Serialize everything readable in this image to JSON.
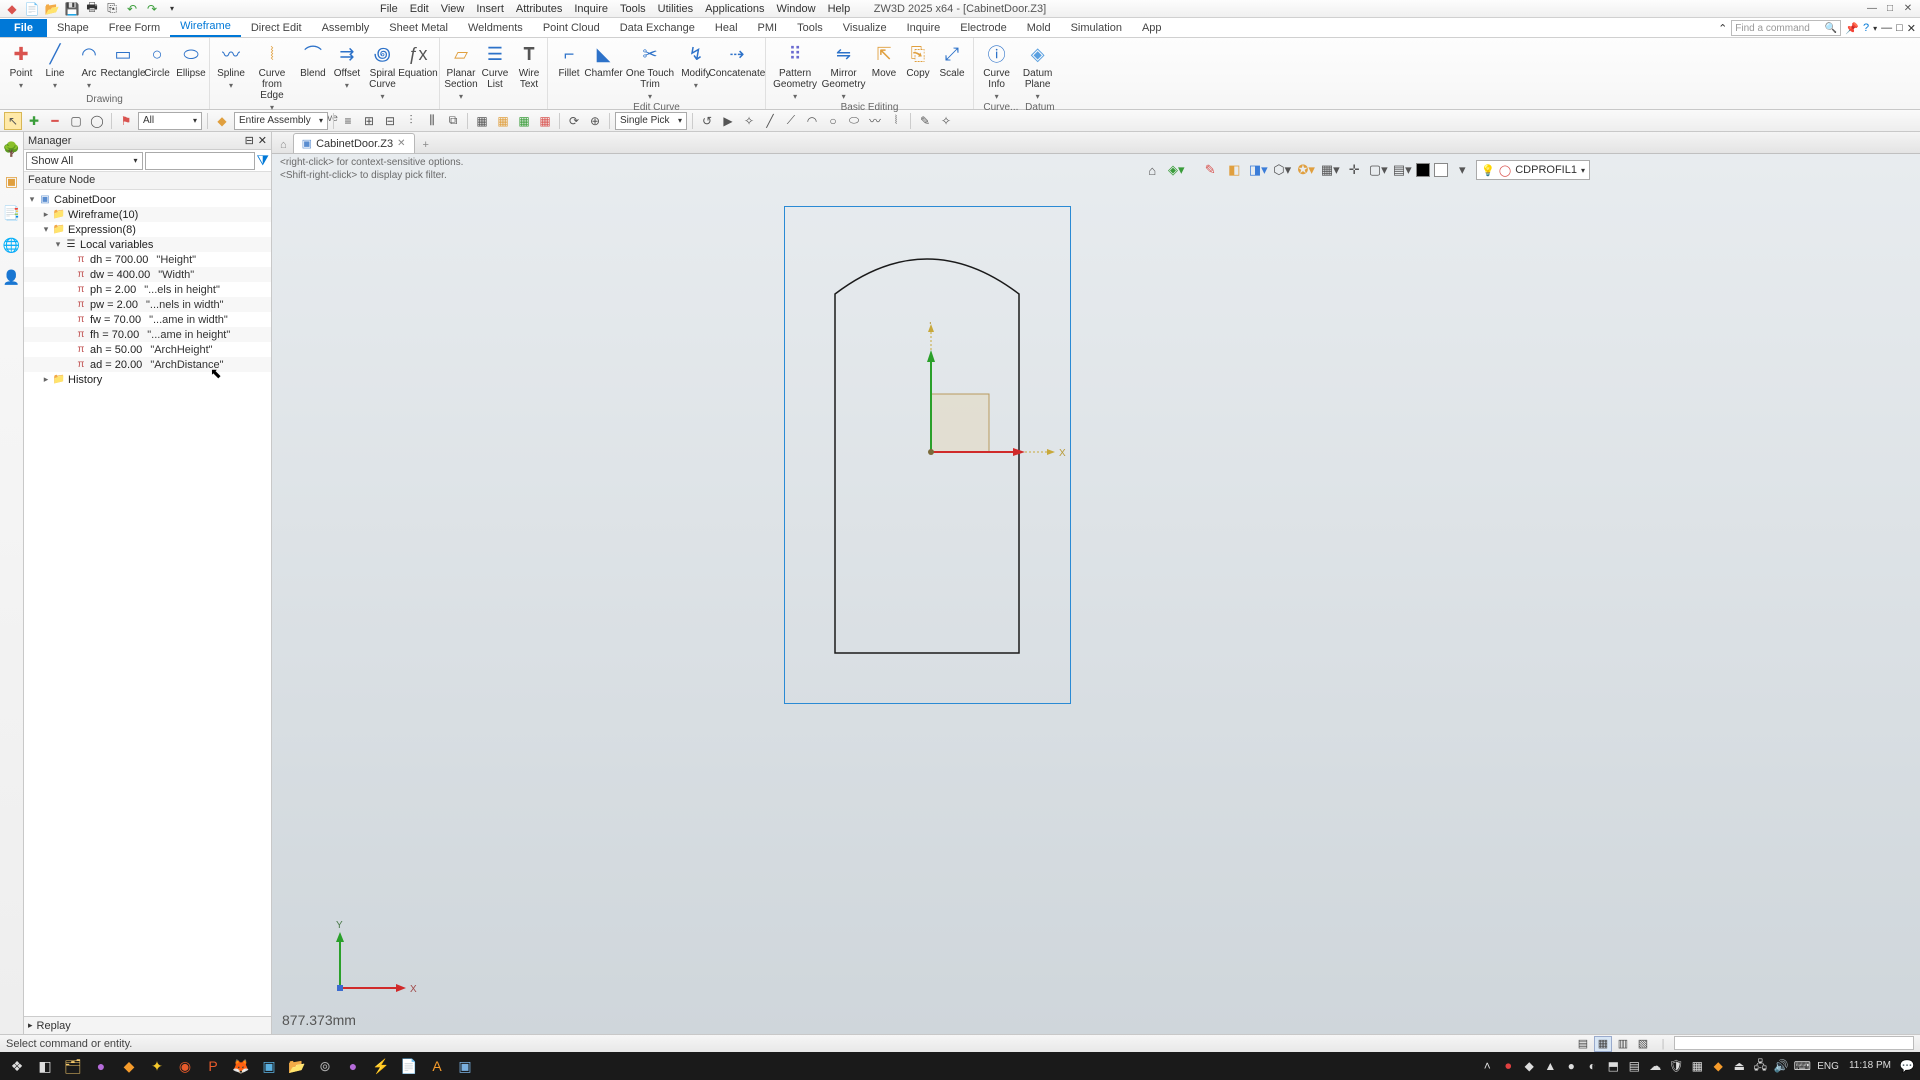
{
  "app": {
    "title": "ZW3D 2025 x64 - [CabinetDoor.Z3]"
  },
  "menu": [
    "File",
    "Edit",
    "View",
    "Insert",
    "Attributes",
    "Inquire",
    "Tools",
    "Utilities",
    "Applications",
    "Window",
    "Help"
  ],
  "tabs": [
    "File",
    "Shape",
    "Free Form",
    "Wireframe",
    "Direct Edit",
    "Assembly",
    "Sheet Metal",
    "Weldments",
    "Point Cloud",
    "Data Exchange",
    "Heal",
    "PMI",
    "Tools",
    "Visualize",
    "Inquire",
    "Electrode",
    "Mold",
    "Simulation",
    "App"
  ],
  "activeTab": "Wireframe",
  "search": {
    "placeholder": "Find a command"
  },
  "ribbon": {
    "drawing": {
      "label": "Drawing",
      "items": [
        "Point",
        "Line",
        "Arc",
        "Rectangle",
        "Circle",
        "Ellipse"
      ]
    },
    "curve": {
      "label": "Curve",
      "items": [
        "Spline",
        "Curve from Edge",
        "Blend",
        "Offset",
        "Spiral Curve",
        "Equation"
      ]
    },
    "section": {
      "label": "",
      "items": [
        "Planar Section",
        "Curve List",
        "Wire Text"
      ]
    },
    "editcurve": {
      "label": "Edit Curve",
      "items": [
        "Fillet",
        "Chamfer",
        "One Touch Trim",
        "Modify",
        "Concatenate"
      ]
    },
    "basic": {
      "label": "Basic Editing",
      "items": [
        "Pattern Geometry",
        "Mirror Geometry",
        "Move",
        "Copy",
        "Scale"
      ]
    },
    "tail": {
      "items": [
        "Curve Info",
        "Datum Plane"
      ],
      "labels": [
        "Curve...",
        "Datum"
      ]
    }
  },
  "toolbar2": {
    "comboAll": "All",
    "comboAssembly": "Entire Assembly",
    "comboPick": "Single Pick"
  },
  "manager": {
    "title": "Manager",
    "showAll": "Show All",
    "header": "Feature Node",
    "root": "CabinetDoor",
    "wireframe": "Wireframe(10)",
    "expression": "Expression(8)",
    "localvars": "Local variables",
    "vars": [
      {
        "expr": "dh = 700.00",
        "desc": "\"Height\""
      },
      {
        "expr": "dw = 400.00",
        "desc": "\"Width\""
      },
      {
        "expr": "ph = 2.00",
        "desc": "\"...els in height\""
      },
      {
        "expr": "pw = 2.00",
        "desc": "\"...nels in width\""
      },
      {
        "expr": "fw = 70.00",
        "desc": "\"...ame in width\""
      },
      {
        "expr": "fh = 70.00",
        "desc": "\"...ame in height\""
      },
      {
        "expr": "ah = 50.00",
        "desc": "\"ArchHeight\""
      },
      {
        "expr": "ad = 20.00",
        "desc": "\"ArchDistance\""
      }
    ],
    "history": "History",
    "replay": "Replay"
  },
  "docTab": {
    "name": "CabinetDoor.Z3"
  },
  "hints": {
    "line1": "<right-click> for context-sensitive options.",
    "line2": "<Shift-right-click> to display pick filter."
  },
  "layer": "CDPROFIL1",
  "viewportDim": "877.373mm",
  "status": {
    "msg": "Select command or entity."
  },
  "tray": {
    "lang": "ENG",
    "time": "11:18 PM"
  }
}
